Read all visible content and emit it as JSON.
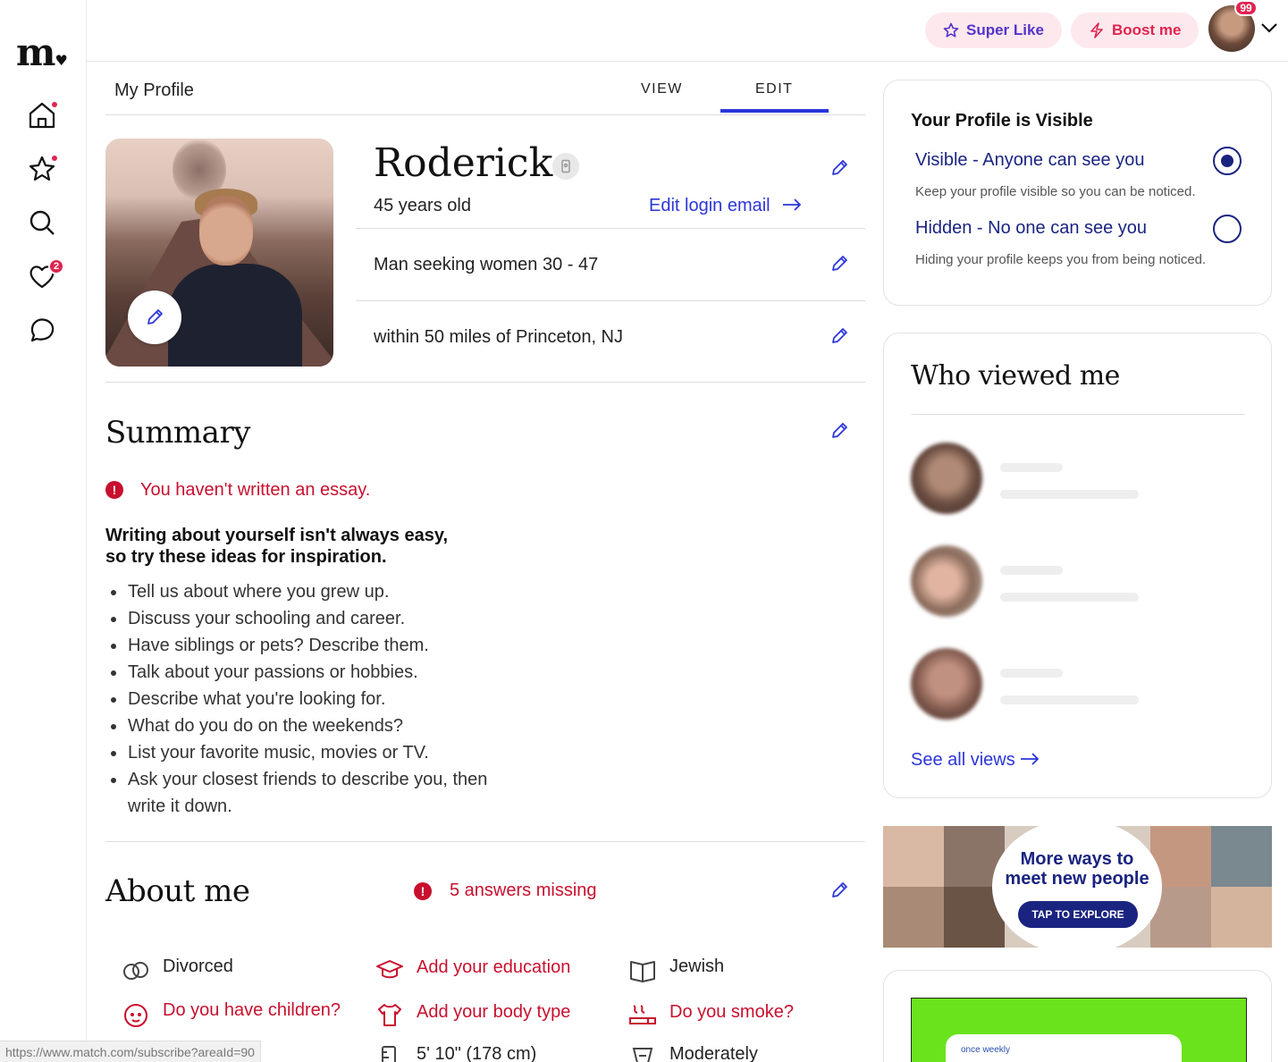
{
  "brand": {
    "logo_text": "m",
    "logo_mark": "♥"
  },
  "topbar": {
    "super_like": "Super Like",
    "boost": "Boost me",
    "notifications": "99"
  },
  "nav": {
    "icons": [
      "home-icon",
      "star-icon",
      "search-icon",
      "heart-icon",
      "chat-icon"
    ],
    "likes_badge": "2"
  },
  "profile": {
    "header_title": "My Profile",
    "tabs": [
      "VIEW",
      "EDIT"
    ],
    "active_tab": "EDIT",
    "name": "Roderick",
    "age": "45 years old",
    "edit_login": "Edit login email",
    "seeking": "Man seeking women 30 - 47",
    "location": "within 50 miles of Princeton, NJ"
  },
  "summary": {
    "title": "Summary",
    "alert": "You haven't written an essay.",
    "tips_heading_1": "Writing about yourself isn't always easy,",
    "tips_heading_2": "so try these ideas for inspiration.",
    "tips": [
      "Tell us about where you grew up.",
      "Discuss your schooling and career.",
      "Have siblings or pets? Describe them.",
      "Talk about your passions or hobbies.",
      "Describe what you're looking for.",
      "What do you do on the weekends?",
      "List your favorite music, movies or TV.",
      "Ask your closest friends to describe you, then write it down."
    ]
  },
  "about": {
    "title": "About me",
    "missing": "5 answers missing",
    "items": [
      {
        "label": "Divorced",
        "icon": "rings-icon",
        "missing": false
      },
      {
        "label": "Add your education",
        "icon": "graduation-cap-icon",
        "missing": true
      },
      {
        "label": "Jewish",
        "icon": "book-icon",
        "missing": false
      },
      {
        "label": "Do you have children?",
        "icon": "child-icon",
        "missing": true
      },
      {
        "label": "Add your body type",
        "icon": "shirt-icon",
        "missing": true
      },
      {
        "label": "Do you smoke?",
        "icon": "smoking-icon",
        "missing": true
      },
      {
        "label": "5' 10\" (178 cm)",
        "icon": "ruler-icon",
        "missing": false
      },
      {
        "label": "Moderately",
        "icon": "drink-icon",
        "missing": false
      }
    ]
  },
  "visibility": {
    "title": "Your Profile is Visible",
    "options": [
      {
        "label": "Visible - Anyone can see you",
        "sub": "Keep your profile visible so you can be noticed.",
        "selected": true
      },
      {
        "label": "Hidden - No one can see you",
        "sub": "Hiding your profile keeps you from being noticed.",
        "selected": false
      }
    ]
  },
  "who_viewed": {
    "title": "Who viewed me",
    "see_all": "See all views"
  },
  "ad": {
    "headline_1": "More ways to",
    "headline_2": "meet new people",
    "button": "TAP TO EXPLORE"
  },
  "green_ad": {
    "small_text": "once weekly"
  },
  "statusbar": {
    "url": "https://www.match.com/subscribe?areaId=90"
  },
  "colors": {
    "accent_blue": "#2b36d9",
    "alert_red": "#c8102e",
    "navy": "#1a2480",
    "pink_pill": "#fde8ee"
  }
}
